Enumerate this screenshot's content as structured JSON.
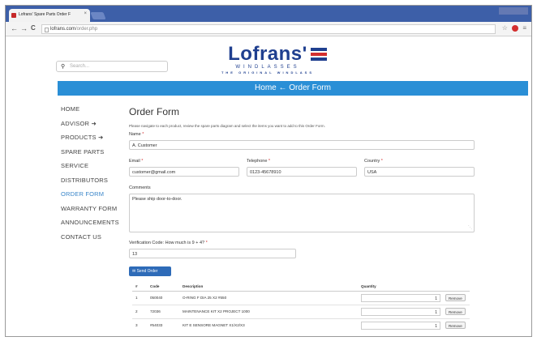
{
  "browser": {
    "tab_title": "Lofrans' Spare Parts Order F",
    "tab_close": "×",
    "back": "←",
    "forward": "→",
    "reload": "C",
    "url_host": "lofrans.com",
    "url_path": "/order.php",
    "star": "☆",
    "menu": "≡"
  },
  "search": {
    "placeholder": "Search...",
    "icon": "magnifier"
  },
  "logo": {
    "brand": "Lofrans'",
    "tagline": "WINDLASSES",
    "subtagline": "THE ORIGINAL WINDLASS"
  },
  "banner": {
    "text": "Home ← Order Form"
  },
  "nav": [
    {
      "label": "HOME"
    },
    {
      "label": "ADVISOR ➜"
    },
    {
      "label": "PRODUCTS ➜"
    },
    {
      "label": "SPARE PARTS"
    },
    {
      "label": "SERVICE"
    },
    {
      "label": "DISTRIBUTORS"
    },
    {
      "label": "ORDER FORM",
      "active": true
    },
    {
      "label": "WARRANTY FORM"
    },
    {
      "label": "ANNOUNCEMENTS"
    },
    {
      "label": "CONTACT US"
    }
  ],
  "form": {
    "title": "Order Form",
    "intro": "Please navigate to each product, review the spare parts diagram and select the items you want to add to this Order Form.",
    "name_label": "Name",
    "name_value": "A. Customer",
    "email_label": "Email",
    "email_value": "customer@gmail.com",
    "phone_label": "Telephone",
    "phone_value": "0123-45678910",
    "country_label": "Country",
    "country_value": "USA",
    "comments_label": "Comments",
    "comments_value": "Please ship door-to-door.",
    "verify_label": "Verification Code: How much is 9 + 4?",
    "verify_value": "13",
    "required_mark": "*",
    "send_button": "Send Order",
    "send_icon": "envelope"
  },
  "table": {
    "headers": [
      "#",
      "Code",
      "Description",
      "Quantity",
      ""
    ],
    "rows": [
      {
        "num": "1",
        "code": "050040",
        "desc": "O-RING F DIA 25 X2 #550",
        "qty": "1",
        "action": "Remove"
      },
      {
        "num": "2",
        "code": "72036",
        "desc": "MAINTENANCE KIT X2 PROJECT 1000",
        "qty": "1",
        "action": "Remove"
      },
      {
        "num": "3",
        "code": "#54033",
        "desc": "KIT E SENSORE MAGNET X1/X2/X3",
        "qty": "1",
        "action": "Remove"
      }
    ]
  },
  "colors": {
    "brand": "#1f3f8f",
    "banner": "#2a8fd6",
    "accent_red": "#d32f2f",
    "button": "#2e6bb8"
  }
}
